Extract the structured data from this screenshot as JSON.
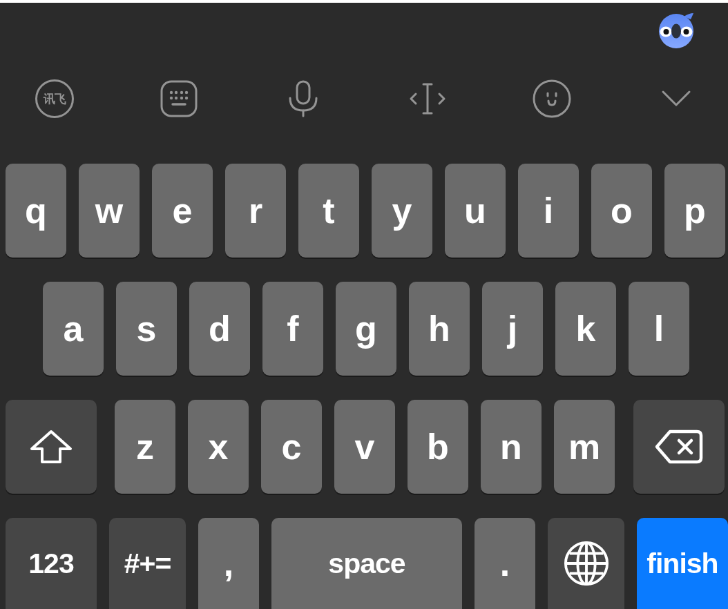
{
  "toolbar": {
    "logo_text": "讯飞"
  },
  "keyboard": {
    "rows": [
      {
        "keys": [
          {
            "kind": "letter",
            "label": "q"
          },
          {
            "kind": "letter",
            "label": "w"
          },
          {
            "kind": "letter",
            "label": "e"
          },
          {
            "kind": "letter",
            "label": "r"
          },
          {
            "kind": "letter",
            "label": "t"
          },
          {
            "kind": "letter",
            "label": "y"
          },
          {
            "kind": "letter",
            "label": "u"
          },
          {
            "kind": "letter",
            "label": "i"
          },
          {
            "kind": "letter",
            "label": "o"
          },
          {
            "kind": "letter",
            "label": "p"
          }
        ]
      },
      {
        "keys": [
          {
            "kind": "letter",
            "label": "a"
          },
          {
            "kind": "letter",
            "label": "s"
          },
          {
            "kind": "letter",
            "label": "d"
          },
          {
            "kind": "letter",
            "label": "f"
          },
          {
            "kind": "letter",
            "label": "g"
          },
          {
            "kind": "letter",
            "label": "h"
          },
          {
            "kind": "letter",
            "label": "j"
          },
          {
            "kind": "letter",
            "label": "k"
          },
          {
            "kind": "letter",
            "label": "l"
          }
        ]
      },
      {
        "keys": [
          {
            "kind": "shift"
          },
          {
            "kind": "letter",
            "label": "z"
          },
          {
            "kind": "letter",
            "label": "x"
          },
          {
            "kind": "letter",
            "label": "c"
          },
          {
            "kind": "letter",
            "label": "v"
          },
          {
            "kind": "letter",
            "label": "b"
          },
          {
            "kind": "letter",
            "label": "n"
          },
          {
            "kind": "letter",
            "label": "m"
          },
          {
            "kind": "backspace"
          }
        ]
      },
      {
        "keys": [
          {
            "kind": "numbers",
            "label": "123"
          },
          {
            "kind": "symbols",
            "label": "#+="
          },
          {
            "kind": "punctuation",
            "label": ","
          },
          {
            "kind": "space",
            "label": "space"
          },
          {
            "kind": "punctuation",
            "label": "."
          },
          {
            "kind": "globe"
          },
          {
            "kind": "return",
            "label": "finish"
          }
        ]
      }
    ]
  }
}
